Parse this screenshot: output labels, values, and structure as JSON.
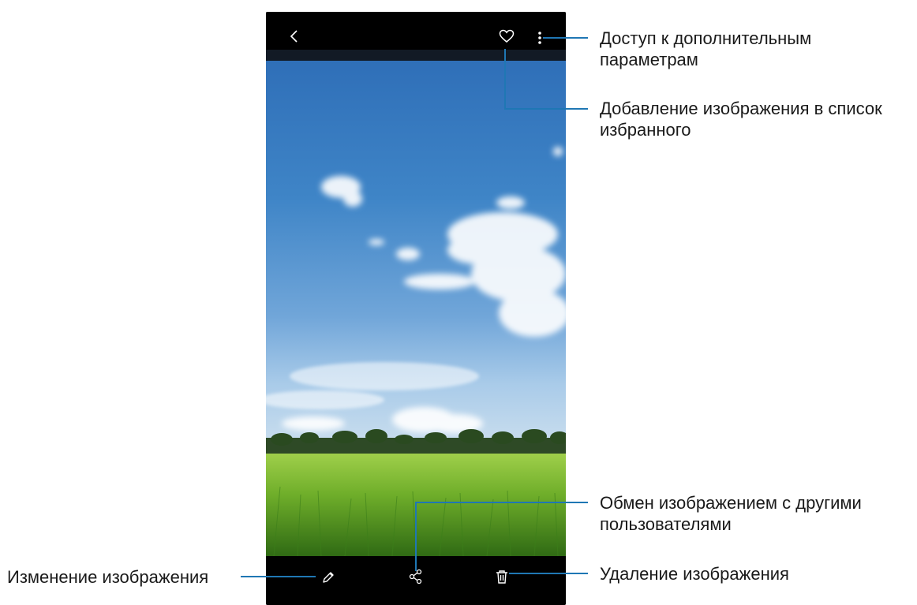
{
  "callouts": {
    "more_options": [
      "Доступ к дополнительным",
      "параметрам"
    ],
    "favorite": [
      "Добавление изображения в список",
      "избранного"
    ],
    "share": [
      "Обмен изображением с другими",
      "пользователями"
    ],
    "delete": "Удаление изображения",
    "edit": "Изменение изображения"
  },
  "icons": {
    "back": "chevron-left-icon",
    "favorite": "heart-outline-icon",
    "more": "more-vertical-icon",
    "edit": "pencil-icon",
    "share": "share-icon",
    "delete": "trash-icon"
  },
  "colors": {
    "callout_line": "#1f77b4",
    "bar_background": "#000000"
  }
}
